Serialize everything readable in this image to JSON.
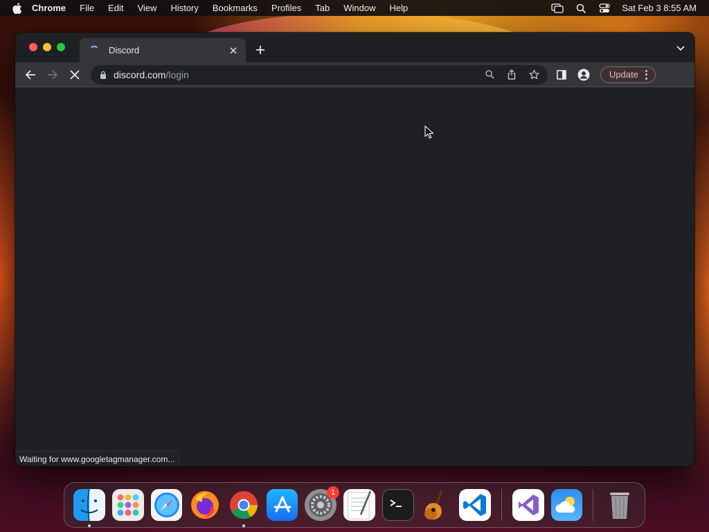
{
  "menubar": {
    "app_name": "Chrome",
    "items": [
      "File",
      "Edit",
      "View",
      "History",
      "Bookmarks",
      "Profiles",
      "Tab",
      "Window",
      "Help"
    ],
    "clock": "Sat Feb 3  8:55 AM"
  },
  "browser": {
    "tab": {
      "title": "Discord",
      "loading": true
    },
    "address": {
      "host": "discord.com",
      "path": "/login"
    },
    "update_label": "Update",
    "status_text": "Waiting for www.googletagmanager.com..."
  },
  "dock": {
    "apps": [
      {
        "name": "Finder",
        "running": true
      },
      {
        "name": "Launchpad",
        "running": false
      },
      {
        "name": "Safari",
        "running": false
      },
      {
        "name": "Firefox",
        "running": false
      },
      {
        "name": "Google Chrome",
        "running": true
      },
      {
        "name": "App Store",
        "running": false
      },
      {
        "name": "System Settings",
        "running": false,
        "badge": "1"
      },
      {
        "name": "TextEdit",
        "running": false
      },
      {
        "name": "Terminal",
        "running": false
      },
      {
        "name": "GarageBand",
        "running": false
      },
      {
        "name": "Visual Studio Code",
        "running": false
      },
      {
        "name": "Visual Studio",
        "running": false
      },
      {
        "name": "Weather",
        "running": false
      },
      {
        "name": "Trash",
        "running": false
      }
    ]
  },
  "colors": {
    "window_bg": "#1f2023",
    "toolbar_bg": "#35363a",
    "update_accent": "#f2b8b5"
  }
}
